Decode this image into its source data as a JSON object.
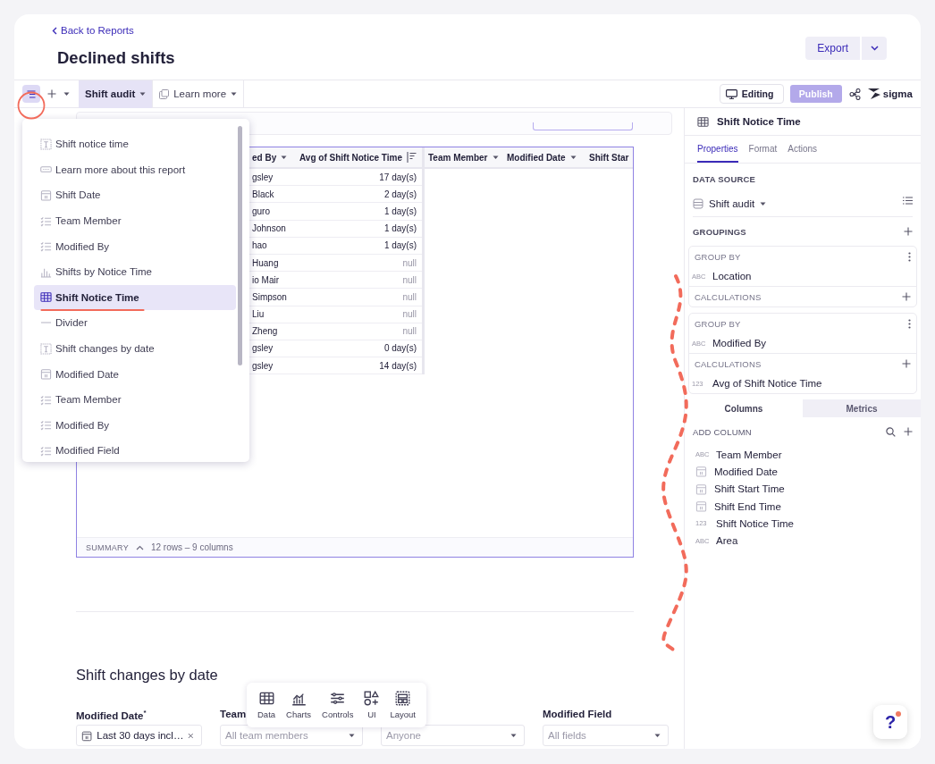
{
  "header": {
    "back_link": "Back to Reports",
    "title": "Declined shifts",
    "export_button": "Export"
  },
  "toolbar": {
    "outline_open": true,
    "tabs": [
      {
        "label": "Shift audit",
        "selected": true,
        "kind": "page"
      },
      {
        "label": "Learn more",
        "selected": false,
        "kind": "link"
      }
    ],
    "editing": "Editing",
    "publish": "Publish",
    "logo": "sigma"
  },
  "outline_menu": {
    "items": [
      {
        "label": "Shift notice time",
        "kind": "text",
        "selected": false
      },
      {
        "label": "Learn more about this report",
        "kind": "button",
        "selected": false
      },
      {
        "label": "Shift Date",
        "kind": "date",
        "selected": false
      },
      {
        "label": "Team Member",
        "kind": "list",
        "selected": false
      },
      {
        "label": "Modified By",
        "kind": "list",
        "selected": false
      },
      {
        "label": "Shifts by Notice Time",
        "kind": "bar",
        "selected": false
      },
      {
        "label": "Shift Notice Time",
        "kind": "table",
        "selected": true
      },
      {
        "label": "Divider",
        "kind": "divider",
        "selected": false
      },
      {
        "label": "Shift changes by date",
        "kind": "text",
        "selected": false
      },
      {
        "label": "Modified Date",
        "kind": "date",
        "selected": false
      },
      {
        "label": "Team Member",
        "kind": "list",
        "selected": false
      },
      {
        "label": "Modified By",
        "kind": "list",
        "selected": false
      },
      {
        "label": "Modified Field",
        "kind": "list",
        "selected": false
      }
    ]
  },
  "table": {
    "columns": [
      {
        "label": "ed By",
        "kind": "menu"
      },
      {
        "label": "Avg of Shift Notice Time",
        "kind": "sorted"
      },
      {
        "label": "Team Member",
        "kind": "menu"
      },
      {
        "label": "Modified Date",
        "kind": "menu"
      },
      {
        "label": "Shift Star",
        "kind": "cut"
      }
    ],
    "rows": [
      {
        "name": "gsley",
        "value": "17 day(s)",
        "is_null": false
      },
      {
        "name": "Black",
        "value": "2 day(s)",
        "is_null": false
      },
      {
        "name": "guro",
        "value": "1 day(s)",
        "is_null": false
      },
      {
        "name": "Johnson",
        "value": "1 day(s)",
        "is_null": false
      },
      {
        "name": "hao",
        "value": "1 day(s)",
        "is_null": false
      },
      {
        "name": "Huang",
        "value": "null",
        "is_null": true
      },
      {
        "name": "io Mair",
        "value": "null",
        "is_null": true
      },
      {
        "name": "Simpson",
        "value": "null",
        "is_null": true
      },
      {
        "name": "Liu",
        "value": "null",
        "is_null": true
      },
      {
        "name": "Zheng",
        "value": "null",
        "is_null": true
      },
      {
        "name": "gsley",
        "value": "0 day(s)",
        "is_null": false
      },
      {
        "name": "gsley",
        "value": "14 day(s)",
        "is_null": false
      }
    ],
    "summary_label": "SUMMARY",
    "summary": "12 rows – 9 columns"
  },
  "section": {
    "title": "Shift changes by date",
    "filters": [
      {
        "label": "Modified Date$^{*}$",
        "value": "Last 30 days incl…",
        "kind": "date"
      },
      {
        "label": "Team",
        "placeholder": "All team members",
        "kind": "select"
      },
      {
        "placeholder": "Anyone",
        "kind": "select"
      },
      {
        "label": "Modified Field",
        "placeholder": "All fields",
        "kind": "select"
      }
    ]
  },
  "add_toolbar": [
    {
      "label": "Data",
      "kind": "table"
    },
    {
      "label": "Charts",
      "kind": "chart"
    },
    {
      "label": "Controls",
      "kind": "sliders"
    },
    {
      "label": "UI",
      "kind": "shapes"
    },
    {
      "label": "Layout",
      "kind": "layout"
    }
  ],
  "help": {
    "label": "?",
    "notification": true
  },
  "panel": {
    "title": "Shift Notice Time",
    "tabs": [
      {
        "label": "Properties",
        "selected": true
      },
      {
        "label": "Format",
        "selected": false
      },
      {
        "label": "Actions",
        "selected": false
      }
    ],
    "data_source_label": "DATA SOURCE",
    "data_source": "Shift audit",
    "groupings_label": "GROUPINGS",
    "groups": [
      {
        "group_label": "GROUP BY",
        "field": {
          "type_label": "ABC",
          "name": "Location"
        },
        "calc_label": "CALCULATIONS"
      },
      {
        "group_label": "GROUP BY",
        "field": {
          "type_label": "ABC",
          "name": "Modified By"
        },
        "calc_label": "CALCULATIONS",
        "calcs": [
          {
            "type_label": "123",
            "name": "Avg of Shift Notice Time"
          }
        ]
      }
    ],
    "segments": [
      {
        "label": "Columns",
        "selected": true
      },
      {
        "label": "Metrics",
        "selected": false
      }
    ],
    "add_column_label": "ADD COLUMN",
    "columns": [
      {
        "name": "Team Member",
        "kind": "text",
        "type_label": "ABC"
      },
      {
        "name": "Modified Date",
        "kind": "date"
      },
      {
        "name": "Shift Start Time",
        "kind": "date"
      },
      {
        "name": "Shift End Time",
        "kind": "date"
      },
      {
        "name": "Shift Notice Time",
        "kind": "text",
        "type_label": "123"
      },
      {
        "name": "Area",
        "kind": "text",
        "type_label": "ABC"
      }
    ]
  }
}
